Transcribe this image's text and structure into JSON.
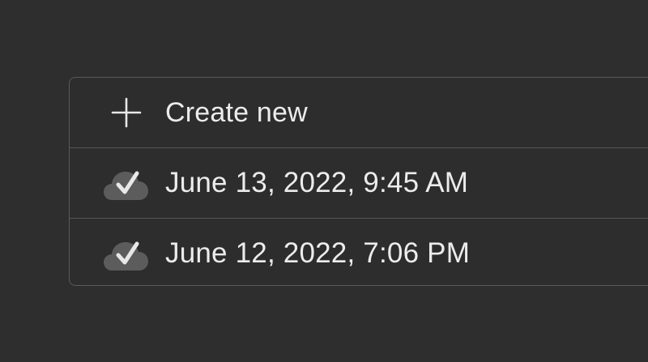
{
  "list": {
    "create_label": "Create new",
    "versions": [
      {
        "label": "June 13, 2022, 9:45 AM",
        "icon": "cloud-check-icon"
      },
      {
        "label": "June 12, 2022, 7:06 PM",
        "icon": "cloud-check-icon"
      }
    ]
  },
  "colors": {
    "background": "#2e2e2e",
    "text": "#ececec",
    "border": "#5a5a5a",
    "cloud": "#5c5c5c",
    "check": "#e8e8e8"
  }
}
